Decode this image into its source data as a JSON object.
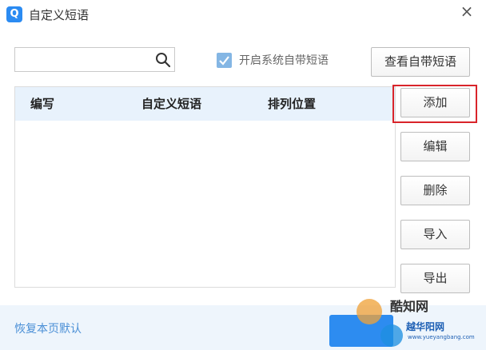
{
  "window": {
    "app_icon_letter": "Q",
    "title": "自定义短语",
    "close_glyph": "×"
  },
  "toolbar": {
    "search_value": "",
    "search_placeholder": "",
    "checkbox_checked": true,
    "checkbox_label": "开启系统自带短语",
    "view_builtin_label": "查看自带短语"
  },
  "table": {
    "columns": [
      "编写",
      "自定义短语",
      "排列位置"
    ],
    "rows": []
  },
  "actions": {
    "add_label": "添加",
    "edit_label": "编辑",
    "delete_label": "删除",
    "import_label": "导入",
    "export_label": "导出"
  },
  "footer": {
    "restore_label": "恢复本页默认"
  },
  "watermark": {
    "site_name_1": "酷知网",
    "site_name_2": "越华阳网",
    "url": "www.yueyangbang.com"
  },
  "colors": {
    "accent": "#2b8bf2",
    "highlight": "#d9242a",
    "header_bg": "#e8f2fc",
    "footer_bg": "#eef5fc"
  }
}
